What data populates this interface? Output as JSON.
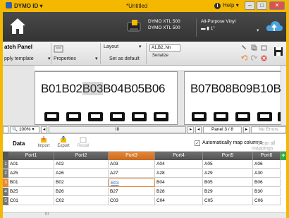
{
  "titlebar": {
    "app_name": "DYMO ID",
    "app_caret": "▾",
    "doc_title": "*Untitled",
    "help_label": "Help",
    "help_caret": "▾",
    "min": "–",
    "max": "□",
    "close": "✕"
  },
  "printer": {
    "line1": "DYMO XTL 500",
    "line2": "DYMO XTL 500",
    "label_type": "All-Purpose Vinyl",
    "label_size": "1\""
  },
  "ribbon": {
    "panel_title": "atch Panel",
    "template_label": "pply template",
    "properties_label": "Properties",
    "layout_label": "Layout",
    "set_default_label": "Set as default",
    "serialize_field": "A1,B2..Nn",
    "serialize_label": "Serialize",
    "caret": "▾"
  },
  "label": {
    "items_left": [
      "B01",
      "B02",
      "B03",
      "B04",
      "B05",
      "B06"
    ],
    "items_right": [
      "B07",
      "B08",
      "B09",
      "B10",
      "B"
    ]
  },
  "statusbar": {
    "zoom": "100%",
    "panel": "Panel 3 / 8",
    "errors": "No Errors",
    "scroll_text": "III"
  },
  "data": {
    "title": "Data",
    "import_label": "Import",
    "export_label": "Export",
    "recall_label": "Recall",
    "automap_label": "Automatically map columns",
    "automap_check": "✓",
    "clear_label": "Clear all mappings",
    "add_col": "+",
    "columns": [
      "Port1",
      "Port2",
      "Port3",
      "Port4",
      "Port5",
      "Port6"
    ],
    "rows": [
      {
        "num": "1",
        "cells": [
          "A01",
          "A02",
          "A03",
          "A04",
          "A05",
          "A06"
        ]
      },
      {
        "num": "2",
        "cells": [
          "A25",
          "A26",
          "A27",
          "A28",
          "A29",
          "A30"
        ]
      },
      {
        "num": "3",
        "cells": [
          "B01",
          "B02",
          "B03",
          "B04",
          "B05",
          "B06"
        ]
      },
      {
        "num": "4",
        "cells": [
          "B25",
          "B26",
          "B27",
          "B28",
          "B29",
          "B30"
        ]
      },
      {
        "num": "5",
        "cells": [
          "C01",
          "C02",
          "C03",
          "C04",
          "C05",
          "C06"
        ]
      }
    ],
    "selected_column_index": 2,
    "selected_row_index": 2,
    "scroll_text": "III"
  },
  "colors": {
    "brand": "#f5b800",
    "selected": "#e5883a",
    "add": "#3aa93a"
  }
}
